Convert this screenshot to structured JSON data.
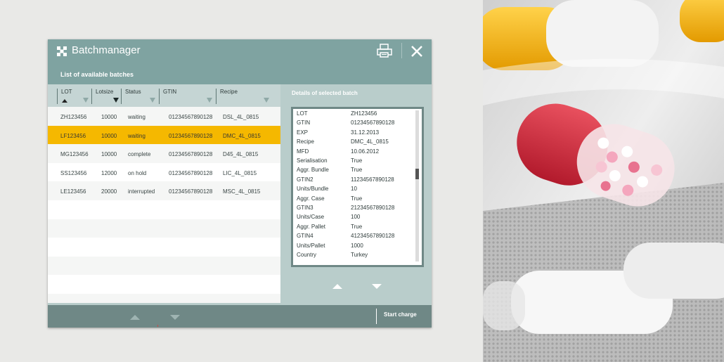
{
  "window": {
    "title": "Batchmanager",
    "subtitle": "List of available batches",
    "details_title": "Details of selected batch",
    "start_label": "Start charge"
  },
  "table": {
    "columns": [
      "LOT",
      "Lotsize",
      "Status",
      "GTIN",
      "Recipe"
    ],
    "rows": [
      {
        "lot": "ZH123456",
        "lotsize": "10000",
        "status": "waiting",
        "gtin": "01234567890128",
        "recipe": "DSL_4L_0815"
      },
      {
        "lot": "LF123456",
        "lotsize": "10000",
        "status": "waiting",
        "gtin": "01234567890128",
        "recipe": "DMC_4L_0815"
      },
      {
        "lot": "MG123456",
        "lotsize": "10000",
        "status": "complete",
        "gtin": "01234567890128",
        "recipe": "D45_4L_0815"
      },
      {
        "lot": "SS123456",
        "lotsize": "12000",
        "status": "on hold",
        "gtin": "01234567890128",
        "recipe": "LIC_4L_0815"
      },
      {
        "lot": "LE123456",
        "lotsize": "20000",
        "status": "interrupted",
        "gtin": "01234567890128",
        "recipe": "MSC_4L_0815"
      }
    ]
  },
  "details": [
    {
      "key": "LOT",
      "value": "ZH123456"
    },
    {
      "key": "GTIN",
      "value": "01234567890128"
    },
    {
      "key": "EXP",
      "value": "31.12.2013"
    },
    {
      "key": "Recipe",
      "value": "DMC_4L_0815"
    },
    {
      "key": "MFD",
      "value": "10.06.2012"
    },
    {
      "key": "Serialisation",
      "value": "True"
    },
    {
      "key": "Aggr. Bundle",
      "value": "True"
    },
    {
      "key": "GTIN2",
      "value": "11234567890128"
    },
    {
      "key": "Units/Bundle",
      "value": "10"
    },
    {
      "key": "Aggr. Case",
      "value": "True"
    },
    {
      "key": "GTIN3",
      "value": "21234567890128"
    },
    {
      "key": "Units/Case",
      "value": "100"
    },
    {
      "key": "Aggr. Pallet",
      "value": "True"
    },
    {
      "key": "GTIN4",
      "value": "41234567890128"
    },
    {
      "key": "Units/Pallet",
      "value": "1000"
    },
    {
      "key": "Country",
      "value": "Turkey"
    }
  ],
  "colors": {
    "titlebar": "#7fa3a1",
    "panel": "#b9cdcb",
    "selected_row": "#f5b800",
    "footer": "#6f8886"
  },
  "icons": [
    "app-grid-icon",
    "print-icon",
    "close-icon",
    "sort-up-icon",
    "filter-icon",
    "arrow-up-icon",
    "arrow-down-icon"
  ]
}
